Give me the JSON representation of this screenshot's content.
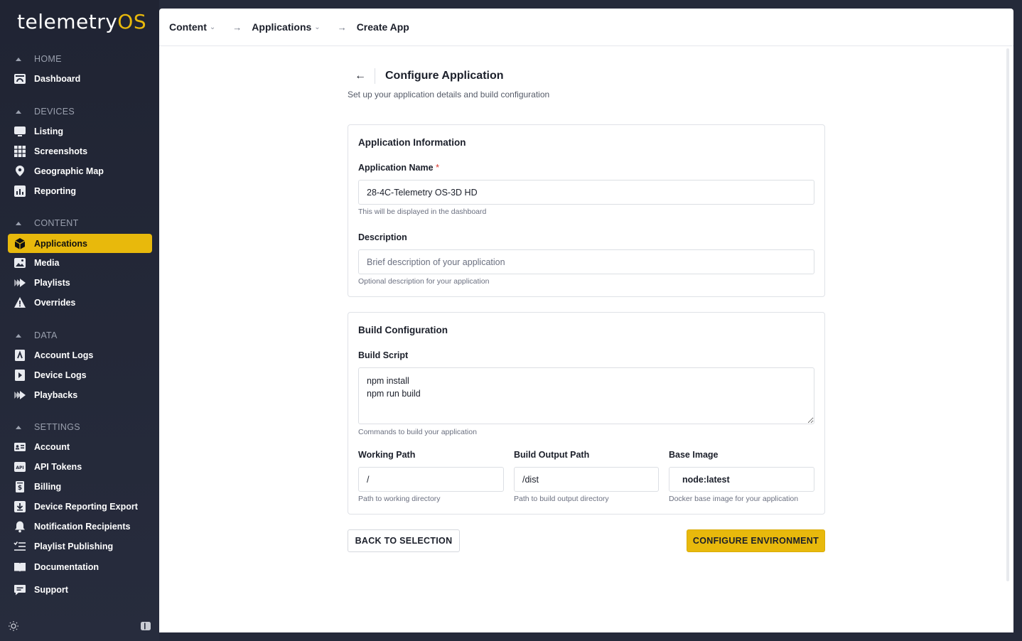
{
  "app": {
    "logo_main": "telemetry",
    "logo_accent": "OS",
    "accent_color": "#e8b90c"
  },
  "sidebar": {
    "sections": {
      "home": "HOME",
      "devices": "DEVICES",
      "content": "CONTENT",
      "data": "DATA",
      "settings": "SETTINGS"
    },
    "items": {
      "dashboard": "Dashboard",
      "listing": "Listing",
      "screenshots": "Screenshots",
      "geographic_map": "Geographic Map",
      "reporting": "Reporting",
      "applications": "Applications",
      "media": "Media",
      "playlists": "Playlists",
      "overrides": "Overrides",
      "account_logs": "Account Logs",
      "device_logs": "Device Logs",
      "playbacks": "Playbacks",
      "account": "Account",
      "api_tokens": "API Tokens",
      "billing": "Billing",
      "device_reporting_export": "Device Reporting Export",
      "notification_recipients": "Notification Recipients",
      "playlist_publishing": "Playlist Publishing",
      "documentation": "Documentation",
      "support": "Support"
    },
    "active_item": "Applications"
  },
  "breadcrumb": {
    "items": [
      "Content",
      "Applications",
      "Create App"
    ],
    "separator": "→"
  },
  "page": {
    "back": "←",
    "title": "Configure Application",
    "subtitle": "Set up your application details and build configuration"
  },
  "app_info": {
    "title": "Application Information",
    "name_label": "Application Name",
    "required_mark": "*",
    "name_value": "28-4C-Telemetry OS-3D HD",
    "name_help": "This will be displayed in the dashboard",
    "description_label": "Description",
    "description_value": "",
    "description_placeholder": "Brief description of your application",
    "description_help": "Optional description for your application"
  },
  "build": {
    "title": "Build Configuration",
    "script_label": "Build Script",
    "script_value": "npm install\nnpm run build",
    "script_help": "Commands to build your application",
    "working_path_label": "Working Path",
    "working_path_value": "/",
    "working_path_help": "Path to working directory",
    "output_path_label": "Build Output Path",
    "output_path_value": "/dist",
    "output_path_help": "Path to build output directory",
    "base_image_label": "Base Image",
    "base_image_value": "node:latest",
    "base_image_help": "Docker base image for your application"
  },
  "actions": {
    "back": "BACK TO SELECTION",
    "configure": "CONFIGURE ENVIRONMENT"
  }
}
